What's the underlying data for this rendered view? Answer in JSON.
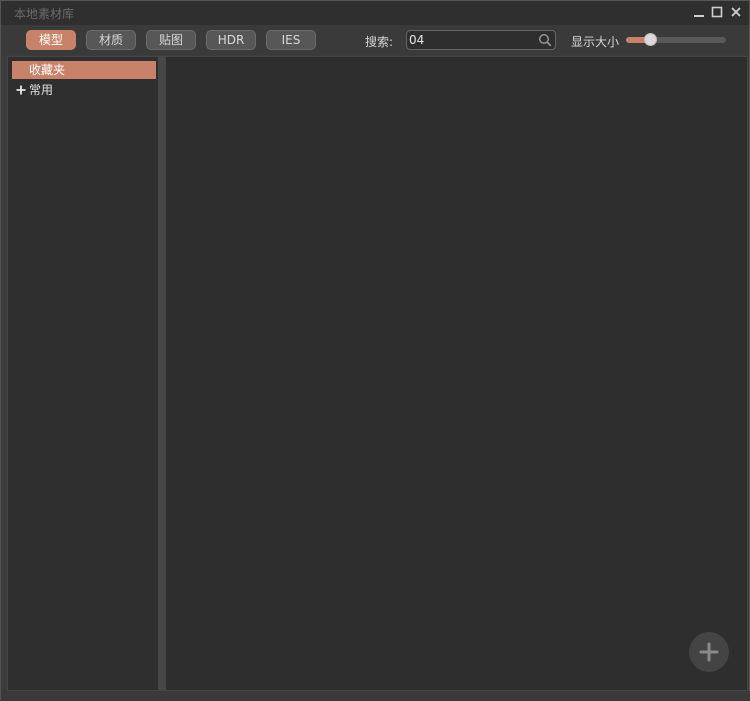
{
  "window": {
    "title": "本地素材库"
  },
  "toolbar": {
    "tabs": [
      {
        "label": "模型",
        "active": true
      },
      {
        "label": "材质",
        "active": false
      },
      {
        "label": "贴图",
        "active": false
      },
      {
        "label": "HDR",
        "active": false
      },
      {
        "label": "IES",
        "active": false
      }
    ],
    "search_label": "搜索:",
    "search_value": "04",
    "size_label": "显示大小",
    "size_value": 0.24
  },
  "sidebar": {
    "items": [
      {
        "label": "收藏夹",
        "selected": true,
        "expandable": false
      },
      {
        "label": "常用",
        "selected": false,
        "expandable": true
      }
    ]
  },
  "colors": {
    "accent": "#c8826a",
    "background": "#2e2e2e",
    "panel": "#3a3a3a"
  },
  "icons": {
    "minimize": "minimize-icon",
    "maximize": "maximize-icon",
    "close": "close-icon",
    "search": "search-icon",
    "expand": "plus-icon",
    "add": "add-icon"
  }
}
